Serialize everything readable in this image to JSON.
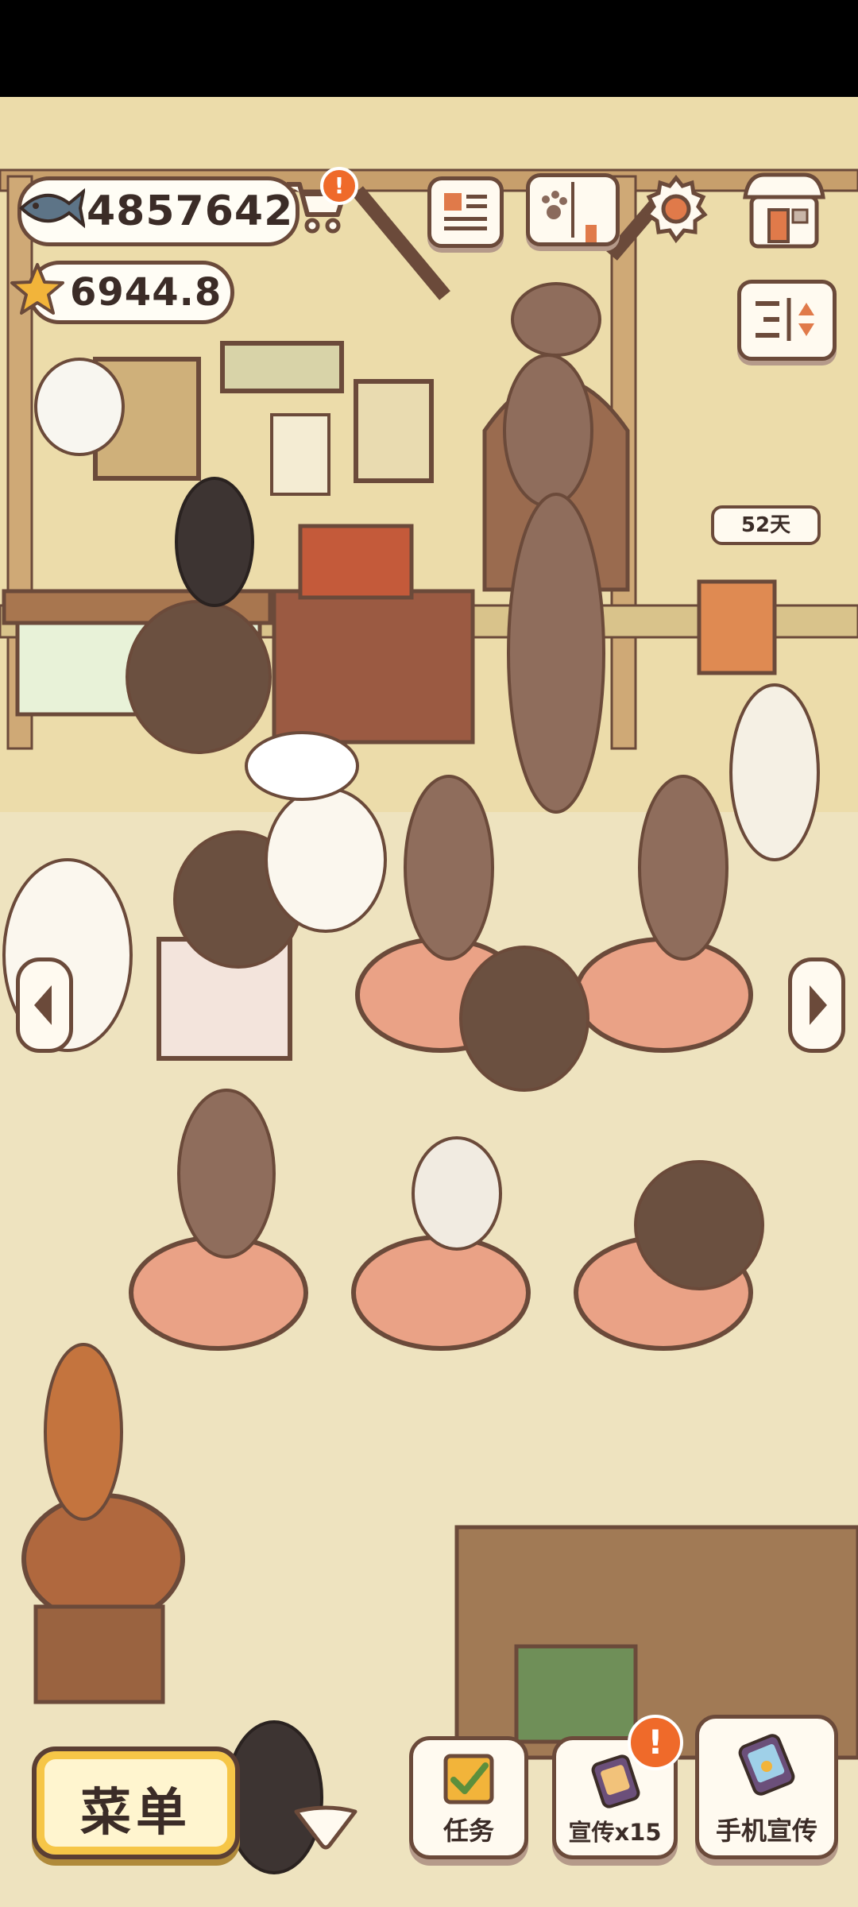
{
  "currencies": {
    "fish": {
      "icon": "fish-icon",
      "value": "4857642"
    },
    "stars": {
      "icon": "star-icon",
      "value": "6944.8"
    }
  },
  "top_bar": {
    "shop_cart": {
      "icon": "cart-icon",
      "badge": "!"
    },
    "newspaper": {
      "icon": "newspaper-icon"
    },
    "recipe_book": {
      "icon": "paw-book-icon"
    },
    "settings": {
      "icon": "gear-icon"
    },
    "store": {
      "icon": "shop-icon"
    },
    "layout_toggle": {
      "icon": "sort-toggle-icon"
    }
  },
  "visitor_timer": {
    "label": "52天"
  },
  "nav": {
    "left": "chevron-left-icon",
    "right": "chevron-right-icon",
    "down": "chevron-down-icon"
  },
  "bottom_bar": {
    "menu": {
      "label": "菜单"
    },
    "tasks": {
      "label": "任务",
      "icon": "checklist-icon"
    },
    "promote": {
      "label": "宣传x15",
      "icon": "phone-icon",
      "badge": "!"
    },
    "phone_promote": {
      "label": "手机宣传",
      "icon": "phone-paw-icon"
    }
  },
  "colors": {
    "wall": "#e9dcb0",
    "floor": "#ece2bc",
    "outline": "#6b4a3a",
    "tablecloth": "#e89a7c",
    "accent": "#ef6a2a",
    "menu_yellow": "#f6c647"
  }
}
